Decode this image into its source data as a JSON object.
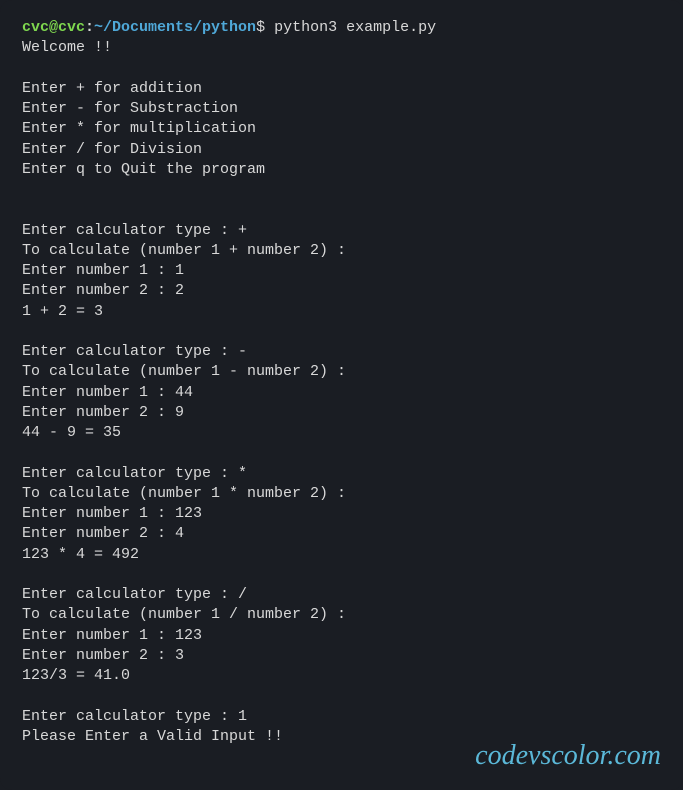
{
  "prompt": {
    "user_host": "cvc@cvc",
    "colon": ":",
    "path": "~/Documents/python",
    "dollar": "$",
    "command": " python3 example.py"
  },
  "output": {
    "welcome": "Welcome !!",
    "blank1": "",
    "menu1": "Enter + for addition",
    "menu2": "Enter - for Substraction",
    "menu3": "Enter * for multiplication",
    "menu4": "Enter / for Division",
    "menu5": "Enter q to Quit the program",
    "blank2": "",
    "blank3": "",
    "add_type": "Enter calculator type : +",
    "add_calc": "To calculate (number 1 + number 2) :",
    "add_n1": "Enter number 1 : 1",
    "add_n2": "Enter number 2 : 2",
    "add_res": "1 + 2 = 3",
    "blank4": "",
    "sub_type": "Enter calculator type : -",
    "sub_calc": "To calculate (number 1 - number 2) :",
    "sub_n1": "Enter number 1 : 44",
    "sub_n2": "Enter number 2 : 9",
    "sub_res": "44 - 9 = 35",
    "blank5": "",
    "mul_type": "Enter calculator type : *",
    "mul_calc": "To calculate (number 1 * number 2) :",
    "mul_n1": "Enter number 1 : 123",
    "mul_n2": "Enter number 2 : 4",
    "mul_res": "123 * 4 = 492",
    "blank6": "",
    "div_type": "Enter calculator type : /",
    "div_calc": "To calculate (number 1 / number 2) :",
    "div_n1": "Enter number 1 : 123",
    "div_n2": "Enter number 2 : 3",
    "div_res": "123/3 = 41.0",
    "blank7": "",
    "inv_type": "Enter calculator type : 1",
    "inv_res": "Please Enter a Valid Input !!"
  },
  "watermark": "codevscolor.com"
}
